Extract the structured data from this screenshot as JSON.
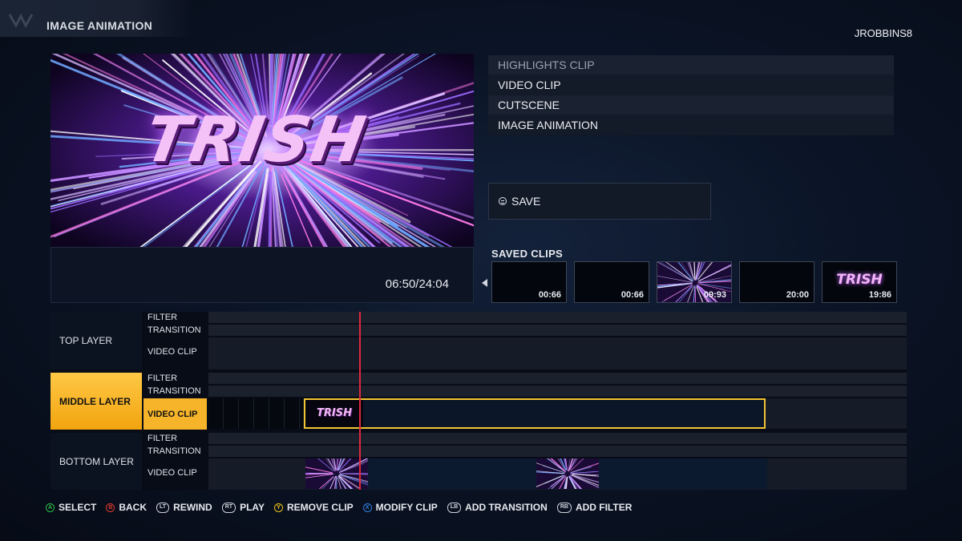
{
  "header": {
    "title": "IMAGE ANIMATION",
    "username": "JROBBINS8"
  },
  "preview": {
    "title_text": "TRISH",
    "timecode": "06:50/24:04"
  },
  "clip_types": [
    {
      "label": "HIGHLIGHTS CLIP",
      "state": "dim"
    },
    {
      "label": "VIDEO CLIP"
    },
    {
      "label": "CUTSCENE"
    },
    {
      "label": "IMAGE ANIMATION"
    }
  ],
  "save": {
    "label": "SAVE"
  },
  "saved_clips": {
    "label": "SAVED CLIPS",
    "items": [
      {
        "time": "00:66"
      },
      {
        "time": "00:66"
      },
      {
        "time": "09:93"
      },
      {
        "time": "20:00"
      },
      {
        "time": "19:86",
        "title": "TRISH"
      }
    ]
  },
  "timeline": {
    "layers": [
      {
        "name": "TOP LAYER",
        "tracks": [
          "FILTER",
          "TRANSITION",
          "VIDEO CLIP"
        ]
      },
      {
        "name": "MIDDLE LAYER",
        "tracks": [
          "FILTER",
          "TRANSITION",
          "VIDEO CLIP"
        ],
        "selected": true
      },
      {
        "name": "BOTTOM LAYER",
        "tracks": [
          "FILTER",
          "TRANSITION",
          "VIDEO CLIP"
        ]
      }
    ],
    "selected_clip_title": "TRISH"
  },
  "hints": [
    {
      "key": "A",
      "label": "SELECT",
      "color": "#2fbf4a"
    },
    {
      "key": "B",
      "label": "BACK",
      "color": "#e2382f"
    },
    {
      "key": "LT",
      "label": "REWIND"
    },
    {
      "key": "RT",
      "label": "PLAY"
    },
    {
      "key": "Y",
      "label": "REMOVE CLIP",
      "color": "#f0c419"
    },
    {
      "key": "X",
      "label": "MODIFY CLIP",
      "color": "#2f7fe0"
    },
    {
      "key": "LB",
      "label": "ADD TRANSITION"
    },
    {
      "key": "RB",
      "label": "ADD FILTER"
    }
  ],
  "colors": {
    "accent": "#f3c431",
    "playhead": "#e0283c",
    "background": "#0b1426"
  }
}
